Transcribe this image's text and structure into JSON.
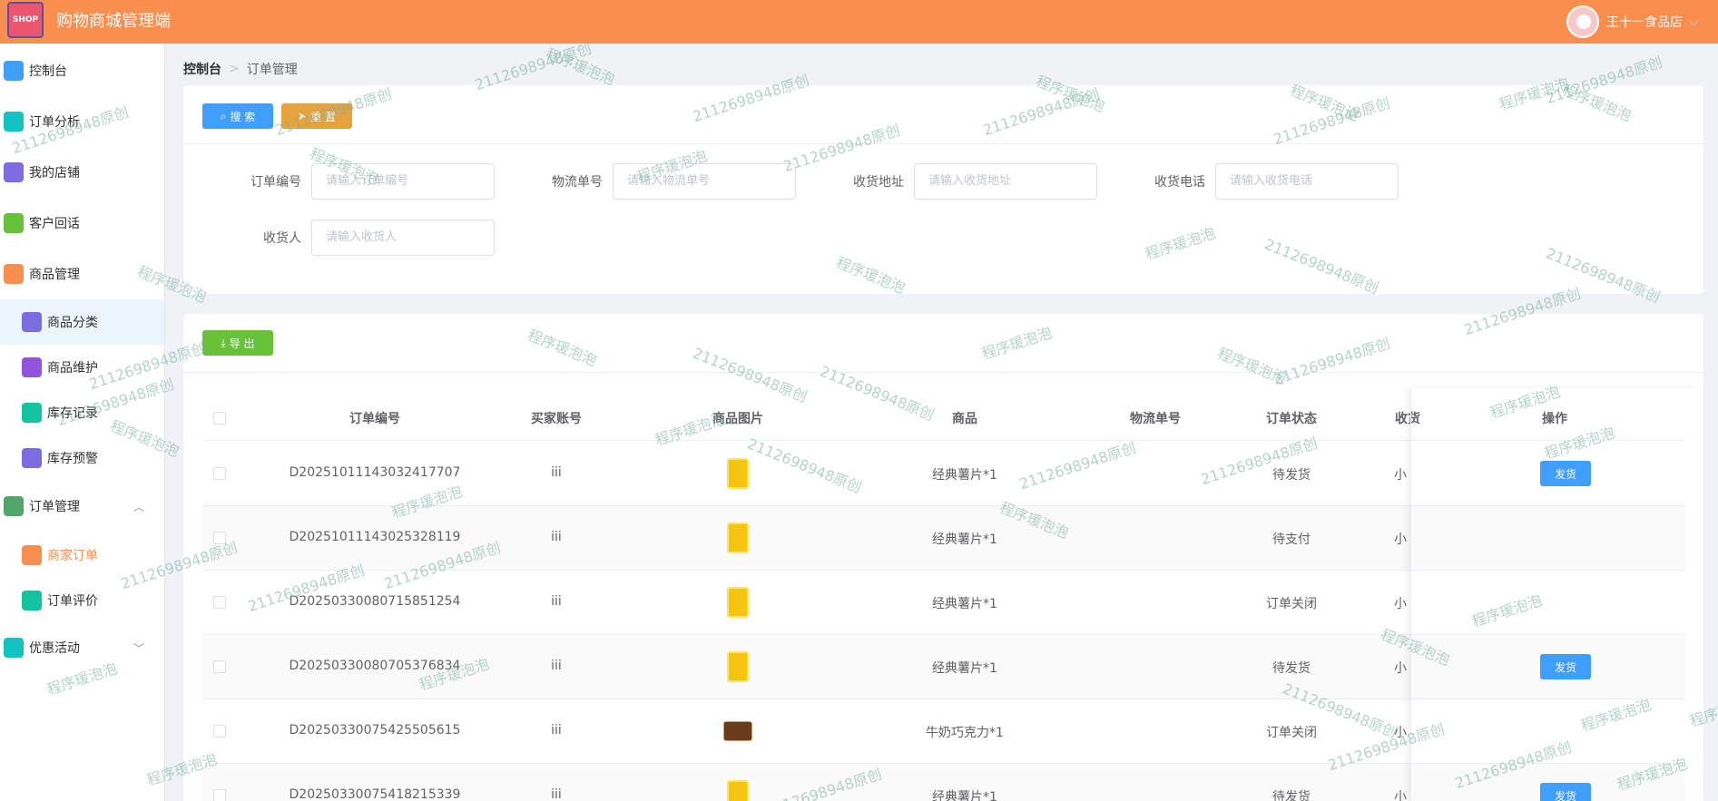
{
  "header": {
    "logo_text": "SHOP",
    "title": "购物商城管理端",
    "user_name": "王十一食品店",
    "chevron": "⌵"
  },
  "sidebar": {
    "items": [
      {
        "label": "控制台",
        "icon": "chart-line-icon",
        "color": "#409eff"
      },
      {
        "label": "订单分析",
        "icon": "pie-chart-icon",
        "color": "#13c2c2"
      },
      {
        "label": "我的店铺",
        "icon": "store-icon",
        "color": "#7c6ce0"
      },
      {
        "label": "客户回话",
        "icon": "chat-icon",
        "color": "#67c23a"
      },
      {
        "label": "商品管理",
        "icon": "bag-icon",
        "color": "#f98f4f"
      },
      {
        "label": "商品分类",
        "icon": "grid-icon",
        "color": "#7c6ce0"
      },
      {
        "label": "商品维护",
        "icon": "basket-icon",
        "color": "#9254de"
      },
      {
        "label": "库存记录",
        "icon": "house-icon",
        "color": "#13c2a0"
      },
      {
        "label": "库存预警",
        "icon": "alert-icon",
        "color": "#7c6ce0"
      },
      {
        "label": "订单管理",
        "icon": "clipboard-icon",
        "color": "#52a66a"
      },
      {
        "label": "商家订单",
        "icon": "bar-chart-icon",
        "color": "#f98f4f"
      },
      {
        "label": "订单评价",
        "icon": "comment-icon",
        "color": "#13c2a0"
      },
      {
        "label": "优惠活动",
        "icon": "gift-icon",
        "color": "#13c2c2"
      }
    ]
  },
  "breadcrumb": {
    "root": "控制台",
    "separator": ">",
    "current": "订单管理"
  },
  "search": {
    "search_label": "搜 索",
    "reset_label": "重 置",
    "fields": [
      {
        "label": "订单编号",
        "placeholder": "请输入订单编号"
      },
      {
        "label": "物流单号",
        "placeholder": "请输入物流单号"
      },
      {
        "label": "收货地址",
        "placeholder": "请输入收货地址"
      },
      {
        "label": "收货电话",
        "placeholder": "请输入收货电话"
      },
      {
        "label": "收货人",
        "placeholder": "请输入收货人"
      }
    ]
  },
  "table": {
    "export_label": "导 出",
    "columns": [
      "订单编号",
      "买家账号",
      "商品图片",
      "商品",
      "物流单号",
      "订单状态",
      "收货",
      "操作"
    ],
    "ship_label": "发货",
    "rows": [
      {
        "order_no": "D20251011143032417707",
        "buyer": "iii",
        "image": "chips",
        "product": "经典薯片*1",
        "logistics": "",
        "status": "待发货",
        "receiver": "小",
        "ship": true
      },
      {
        "order_no": "D20251011143025328119",
        "buyer": "iii",
        "image": "chips",
        "product": "经典薯片*1",
        "logistics": "",
        "status": "待支付",
        "receiver": "小",
        "ship": false
      },
      {
        "order_no": "D20250330080715851254",
        "buyer": "iii",
        "image": "chips",
        "product": "经典薯片*1",
        "logistics": "",
        "status": "订单关闭",
        "receiver": "小",
        "ship": false
      },
      {
        "order_no": "D20250330080705376834",
        "buyer": "iii",
        "image": "chips",
        "product": "经典薯片*1",
        "logistics": "",
        "status": "待发货",
        "receiver": "小",
        "ship": true
      },
      {
        "order_no": "D20250330075425505615",
        "buyer": "iii",
        "image": "choco",
        "product": "牛奶巧克力*1",
        "logistics": "",
        "status": "订单关闭",
        "receiver": "小",
        "ship": false
      },
      {
        "order_no": "D20250330075418215339",
        "buyer": "iii",
        "image": "chips",
        "product": "经典薯片*1",
        "logistics": "",
        "status": "待发货",
        "receiver": "小",
        "ship": true
      }
    ]
  },
  "watermark": {
    "text_a": "2112698948原创",
    "text_b": "程序瑗泡泡"
  }
}
